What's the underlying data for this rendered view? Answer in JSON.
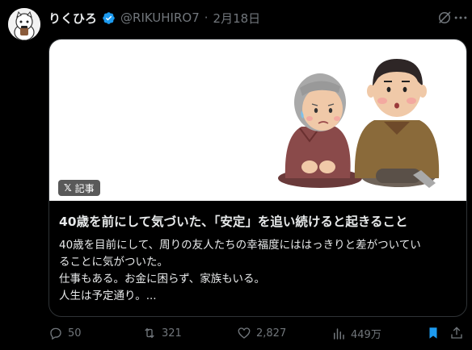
{
  "author": {
    "name": "りくひろ",
    "handle": "@RIKUHIRO7",
    "separator": "·",
    "date": "2月18日"
  },
  "card": {
    "badge_label": "記事",
    "badge_logo": "𝕏",
    "title": "40歳を前にして気づいた、「安定」を追い続けると起きること",
    "description_lines": [
      "40歳を目前にして、周りの友人たちの幸福度にははっきりと差がついてい",
      "ることに気がついた。",
      "仕事もある。お金に困らず、家族もいる。",
      "人生は予定通り。..."
    ]
  },
  "actions": {
    "replies": "50",
    "reposts": "321",
    "likes": "2,827",
    "views": "449万"
  },
  "colors": {
    "background": "#000000",
    "text_primary": "#e7e9ea",
    "text_secondary": "#71767b",
    "verified": "#1d9bf0",
    "bookmark_active": "#1d9bf0"
  },
  "icons": [
    "verified-badge-icon",
    "grok-icon",
    "more-icon",
    "reply-icon",
    "repost-icon",
    "like-icon",
    "views-icon",
    "bookmark-icon",
    "share-icon"
  ]
}
